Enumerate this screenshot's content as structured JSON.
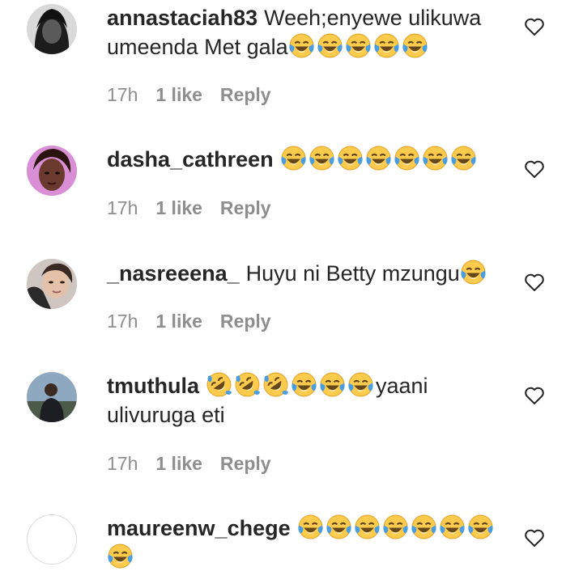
{
  "comments": [
    {
      "username": "annastaciah83",
      "text": "Weeh;enyewe ulikuwa umeenda Met gala",
      "emoji": [
        "face-tears-of-joy",
        "face-tears-of-joy",
        "face-tears-of-joy",
        "face-tears-of-joy",
        "face-tears-of-joy"
      ],
      "time": "17h",
      "likes": "1 like",
      "reply": "Reply",
      "avatar": "avatar-photo"
    },
    {
      "username": "dasha_cathreen",
      "text": "",
      "emoji": [
        "face-tears-of-joy",
        "face-tears-of-joy",
        "face-tears-of-joy",
        "face-tears-of-joy",
        "face-tears-of-joy",
        "face-tears-of-joy",
        "face-tears-of-joy"
      ],
      "time": "17h",
      "likes": "1 like",
      "reply": "Reply",
      "avatar": "avatar-photo"
    },
    {
      "username": "_nasreeena_",
      "text": "Huyu ni Betty mzungu",
      "emoji": [
        "face-tears-of-joy"
      ],
      "time": "17h",
      "likes": "1 like",
      "reply": "Reply",
      "avatar": "avatar-photo"
    },
    {
      "username": "tmuthula",
      "text_after_emoji": "yaani ulivuruga eti",
      "emoji": [
        "rolling-on-floor-laughing",
        "rolling-on-floor-laughing",
        "rolling-on-floor-laughing",
        "face-tears-of-joy",
        "face-tears-of-joy",
        "face-tears-of-joy"
      ],
      "time": "17h",
      "likes": "1 like",
      "reply": "Reply",
      "avatar": "avatar-photo"
    },
    {
      "username": "maureenw_chege",
      "text": "",
      "emoji": [
        "face-tears-of-joy",
        "face-tears-of-joy",
        "face-tears-of-joy",
        "face-tears-of-joy",
        "face-tears-of-joy",
        "face-tears-of-joy",
        "face-tears-of-joy",
        "face-tears-of-joy"
      ],
      "avatar": "avatar-empty"
    }
  ],
  "colors": {
    "text": "#262626",
    "meta": "#8e8e8e",
    "emoji_face": "#ffcb4c",
    "emoji_tears": "#4a9ee0"
  }
}
